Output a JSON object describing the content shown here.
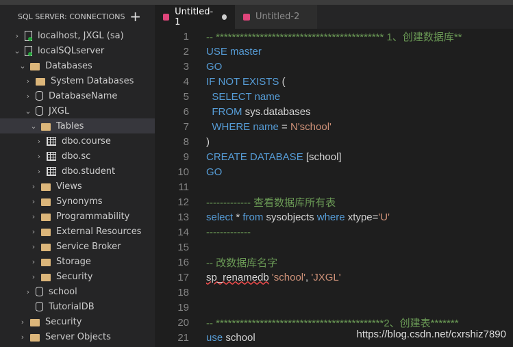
{
  "sidebar": {
    "title": "SQL SERVER: CONNECTIONS",
    "add_icon": "plus-icon",
    "tree": [
      {
        "label": "localhost, JXGL (sa)",
        "level": 0,
        "icon": "server",
        "chev": "right"
      },
      {
        "label": "localSQLserver",
        "level": 0,
        "icon": "server",
        "chev": "down"
      },
      {
        "label": "Databases",
        "level": 1,
        "icon": "folder",
        "chev": "down"
      },
      {
        "label": "System Databases",
        "level": 2,
        "icon": "folder",
        "chev": "right"
      },
      {
        "label": "DatabaseName",
        "level": 2,
        "icon": "db",
        "chev": "right"
      },
      {
        "label": "JXGL",
        "level": 2,
        "icon": "db",
        "chev": "down"
      },
      {
        "label": "Tables",
        "level": 3,
        "icon": "folder",
        "chev": "down",
        "selected": true
      },
      {
        "label": "dbo.course",
        "level": 4,
        "icon": "table",
        "chev": "right"
      },
      {
        "label": "dbo.sc",
        "level": 4,
        "icon": "table",
        "chev": "right"
      },
      {
        "label": "dbo.student",
        "level": 4,
        "icon": "table",
        "chev": "right"
      },
      {
        "label": "Views",
        "level": 3,
        "icon": "folder",
        "chev": "right"
      },
      {
        "label": "Synonyms",
        "level": 3,
        "icon": "folder",
        "chev": "right"
      },
      {
        "label": "Programmability",
        "level": 3,
        "icon": "folder",
        "chev": "right"
      },
      {
        "label": "External Resources",
        "level": 3,
        "icon": "folder",
        "chev": "right"
      },
      {
        "label": "Service Broker",
        "level": 3,
        "icon": "folder",
        "chev": "right"
      },
      {
        "label": "Storage",
        "level": 3,
        "icon": "folder",
        "chev": "right"
      },
      {
        "label": "Security",
        "level": 3,
        "icon": "folder",
        "chev": "right"
      },
      {
        "label": "school",
        "level": 2,
        "icon": "db",
        "chev": "right"
      },
      {
        "label": "TutorialDB",
        "level": 2,
        "icon": "db",
        "chev": ""
      },
      {
        "label": "Security",
        "level": 1,
        "icon": "folder",
        "chev": "right"
      },
      {
        "label": "Server Objects",
        "level": 1,
        "icon": "folder",
        "chev": "right"
      }
    ]
  },
  "tabs": [
    {
      "label": "Untitled-1",
      "active": true,
      "dirty": true
    },
    {
      "label": "Untitled-2",
      "active": false
    }
  ],
  "editor": {
    "lines": [
      [
        [
          "c",
          "-- ****************************************** 1、创建数据库**"
        ]
      ],
      [
        [
          "k",
          "USE master"
        ]
      ],
      [
        [
          "k",
          "GO"
        ]
      ],
      [
        [
          "k",
          "IF NOT EXISTS "
        ],
        [
          "t",
          "("
        ]
      ],
      [
        [
          "k",
          "  SELECT name"
        ]
      ],
      [
        [
          "k",
          "  FROM "
        ],
        [
          "t",
          "sys.databases"
        ]
      ],
      [
        [
          "k",
          "  WHERE "
        ],
        [
          "k",
          "name"
        ],
        [
          "t",
          " = "
        ],
        [
          "s",
          "N'school'"
        ]
      ],
      [
        [
          "t",
          ")"
        ]
      ],
      [
        [
          "k",
          "CREATE DATABASE "
        ],
        [
          "t",
          "[school]"
        ]
      ],
      [
        [
          "k",
          "GO"
        ]
      ],
      [],
      [
        [
          "c",
          "------------- 查看数据库所有表"
        ]
      ],
      [
        [
          "k",
          "select "
        ],
        [
          "t",
          "* "
        ],
        [
          "k",
          "from "
        ],
        [
          "t",
          "sysobjects "
        ],
        [
          "k",
          "where "
        ],
        [
          "t",
          "xtype="
        ],
        [
          "s",
          "'U'"
        ]
      ],
      [
        [
          "c",
          "-------------"
        ]
      ],
      [],
      [
        [
          "c",
          "-- 改数据库名字"
        ]
      ],
      [
        [
          "terr",
          "sp_renamedb"
        ],
        [
          "t",
          " "
        ],
        [
          "s",
          "'school'"
        ],
        [
          "t",
          ", "
        ],
        [
          "s",
          "'JXGL'"
        ]
      ],
      [],
      [],
      [
        [
          "c",
          "-- ******************************************2、创建表*******"
        ]
      ],
      [
        [
          "k",
          "use "
        ],
        [
          "t",
          "school"
        ]
      ]
    ]
  },
  "watermark": "https://blog.csdn.net/cxrshiz7890"
}
